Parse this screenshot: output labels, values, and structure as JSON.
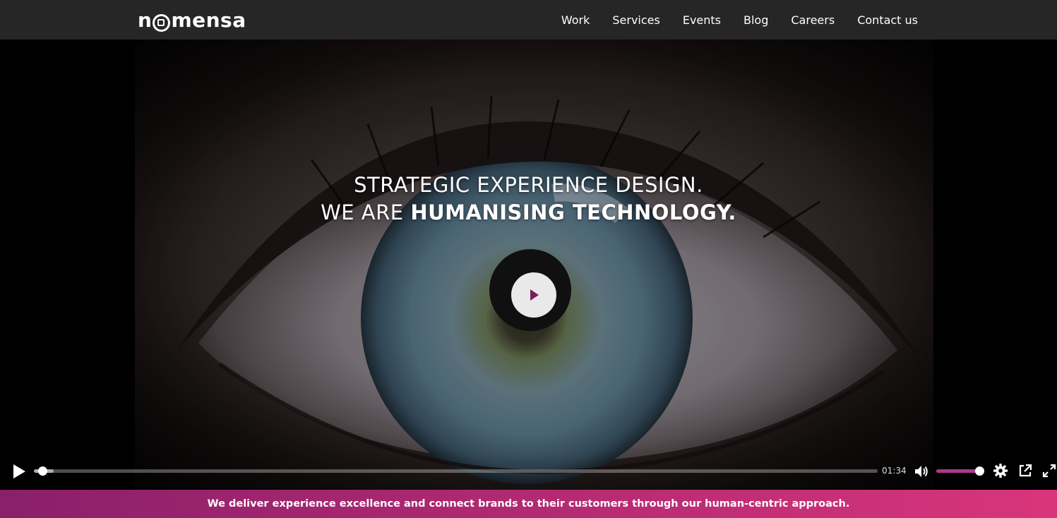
{
  "brand": {
    "logo_text_start": "n",
    "logo_text_end": "mensa",
    "accent": "#8b2a6c"
  },
  "nav": {
    "items": [
      "Work",
      "Services",
      "Events",
      "Blog",
      "Careers",
      "Contact us"
    ]
  },
  "hero": {
    "line1": "STRATEGIC EXPERIENCE DESIGN.",
    "line2_light": "WE ARE ",
    "line2_bold": "HUMANISING TECHNOLOGY.",
    "play_color": "#7a1f5e"
  },
  "player": {
    "elapsed_fraction": 0.005,
    "time": "01:34",
    "volume_fraction": 1.0,
    "volume_color": "#a83a8c"
  },
  "banner": {
    "text": "We deliver experience excellence and connect brands to their customers through our human-centric approach.",
    "gradient_start": "#8a1f6a",
    "gradient_end": "#d9357a"
  }
}
